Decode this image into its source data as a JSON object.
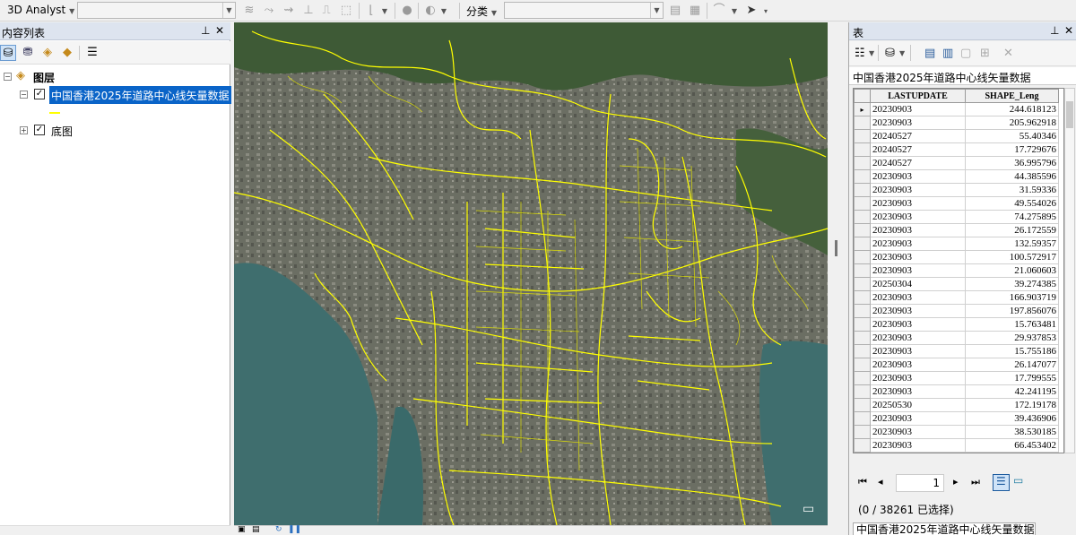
{
  "toolbar": {
    "analyst_label": "3D Analyst",
    "classify_label": "分类"
  },
  "toc": {
    "title": "内容列表",
    "root_label": "图层",
    "layers": [
      {
        "label": "中国香港2025年道路中心线矢量数据",
        "checked": true,
        "selected": true,
        "symbol_color": "#ffff00"
      },
      {
        "label": "底图",
        "checked": true,
        "selected": false
      }
    ]
  },
  "map": {
    "road_color": "#ffff00",
    "water_color": "#3f6e6e"
  },
  "table": {
    "title": "表",
    "tab_label": "中国香港2025年道路中心线矢量数据",
    "columns": [
      "LASTUPDATE",
      "SHAPE_Leng"
    ],
    "rows": [
      [
        "20230903",
        "244.618123"
      ],
      [
        "20230903",
        "205.962918"
      ],
      [
        "20240527",
        "55.40346"
      ],
      [
        "20240527",
        "17.729676"
      ],
      [
        "20240527",
        "36.995796"
      ],
      [
        "20230903",
        "44.385596"
      ],
      [
        "20230903",
        "31.59336"
      ],
      [
        "20230903",
        "49.554026"
      ],
      [
        "20230903",
        "74.275895"
      ],
      [
        "20230903",
        "26.172559"
      ],
      [
        "20230903",
        "132.59357"
      ],
      [
        "20230903",
        "100.572917"
      ],
      [
        "20230903",
        "21.060603"
      ],
      [
        "20250304",
        "39.274385"
      ],
      [
        "20230903",
        "166.903719"
      ],
      [
        "20230903",
        "197.856076"
      ],
      [
        "20230903",
        "15.763481"
      ],
      [
        "20230903",
        "29.937853"
      ],
      [
        "20230903",
        "15.755186"
      ],
      [
        "20230903",
        "26.147077"
      ],
      [
        "20230903",
        "17.799555"
      ],
      [
        "20230903",
        "42.241195"
      ],
      [
        "20250530",
        "172.19178"
      ],
      [
        "20230903",
        "39.436906"
      ],
      [
        "20230903",
        "38.530185"
      ],
      [
        "20230903",
        "66.453402"
      ]
    ],
    "current_row_marker": "▸",
    "page_value": "1",
    "selection_status": "(0 / 38261 已选择)",
    "bottom_tab_label": "中国香港2025年道路中心线矢量数据"
  }
}
